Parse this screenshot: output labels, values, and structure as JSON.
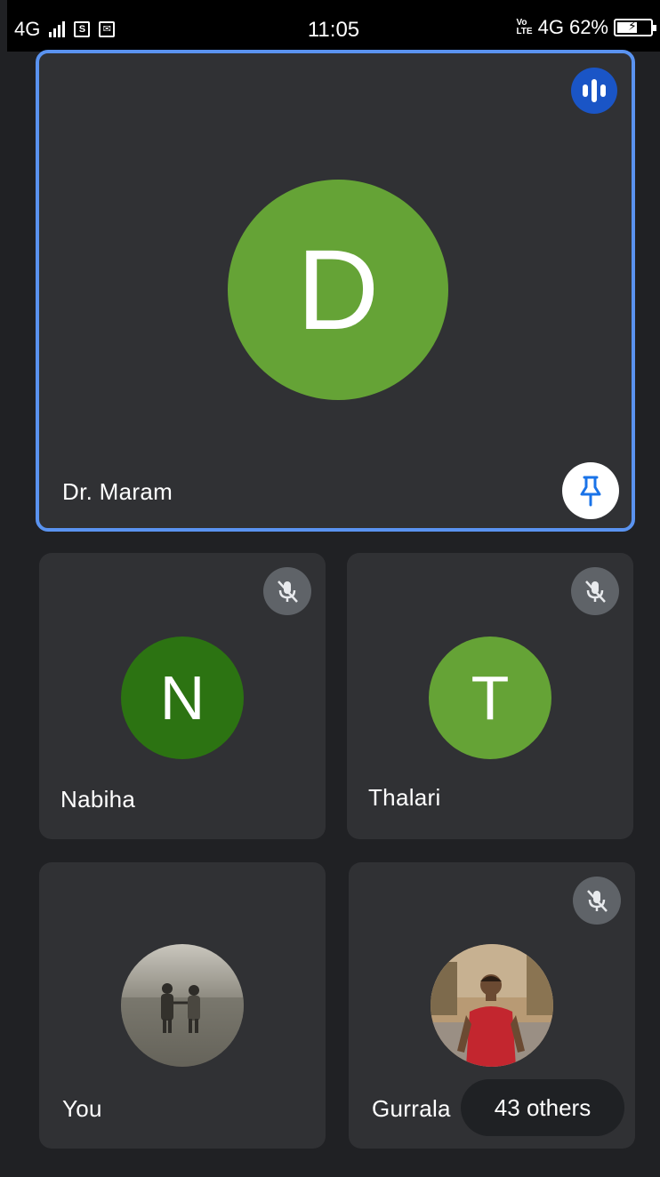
{
  "status_bar": {
    "network_left": "4G",
    "time": "11:05",
    "volte_top": "Vo",
    "volte_bottom": "LTE",
    "network_right": "4G",
    "battery": "62%",
    "battery_level": 0.62
  },
  "main_tile": {
    "initial": "D",
    "name": "Dr. Maram",
    "avatar_color": "#65a336",
    "border_color": "#5a93f0"
  },
  "tiles": [
    {
      "initial": "N",
      "name": "Nabiha",
      "avatar_color": "#2c7312",
      "muted": true
    },
    {
      "initial": "T",
      "name": "Thalari",
      "avatar_color": "#65a336",
      "muted": true
    },
    {
      "initial": "",
      "name": "You",
      "avatar_color": "#777",
      "muted": false
    },
    {
      "initial": "",
      "name": "Gurrala",
      "avatar_color": "#9a7b58",
      "muted": true
    }
  ],
  "others_label": "43 others",
  "icons": {
    "speaking": "audio-wave-icon",
    "pin": "pin-icon",
    "mic_off": "mic-off-icon"
  }
}
